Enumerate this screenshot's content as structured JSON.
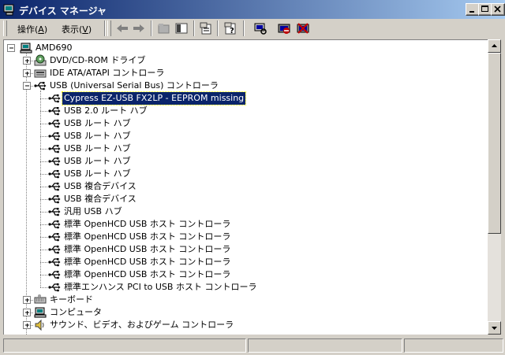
{
  "window": {
    "title": "デバイス マネージャ"
  },
  "menu": [
    {
      "label": "操作(",
      "key": "A",
      "suffix": ")"
    },
    {
      "label": "表示(",
      "key": "V",
      "suffix": ")"
    }
  ],
  "tree": {
    "root": "AMD690",
    "items": [
      {
        "label": "DVD/CD-ROM ドライブ",
        "icon": "cdrom-icon",
        "level": 1,
        "expander": "plus"
      },
      {
        "label": "IDE ATA/ATAPI コントローラ",
        "icon": "ide-controller-icon",
        "level": 1,
        "expander": "plus"
      },
      {
        "label": "USB (Universal Serial Bus) コントローラ",
        "icon": "usb-icon",
        "level": 1,
        "expander": "minus"
      },
      {
        "label": "Cypress EZ-USB FX2LP - EEPROM missing",
        "icon": "usb-icon",
        "level": 2,
        "selected": true
      },
      {
        "label": "USB 2.0 ルート ハブ",
        "icon": "usb-icon",
        "level": 2
      },
      {
        "label": "USB ルート ハブ",
        "icon": "usb-icon",
        "level": 2
      },
      {
        "label": "USB ルート ハブ",
        "icon": "usb-icon",
        "level": 2
      },
      {
        "label": "USB ルート ハブ",
        "icon": "usb-icon",
        "level": 2
      },
      {
        "label": "USB ルート ハブ",
        "icon": "usb-icon",
        "level": 2
      },
      {
        "label": "USB ルート ハブ",
        "icon": "usb-icon",
        "level": 2
      },
      {
        "label": "USB 複合デバイス",
        "icon": "usb-icon",
        "level": 2
      },
      {
        "label": "USB 複合デバイス",
        "icon": "usb-icon",
        "level": 2
      },
      {
        "label": "汎用 USB ハブ",
        "icon": "usb-icon",
        "level": 2
      },
      {
        "label": "標準 OpenHCD USB ホスト コントローラ",
        "icon": "usb-icon",
        "level": 2
      },
      {
        "label": "標準 OpenHCD USB ホスト コントローラ",
        "icon": "usb-icon",
        "level": 2
      },
      {
        "label": "標準 OpenHCD USB ホスト コントローラ",
        "icon": "usb-icon",
        "level": 2
      },
      {
        "label": "標準 OpenHCD USB ホスト コントローラ",
        "icon": "usb-icon",
        "level": 2
      },
      {
        "label": "標準 OpenHCD USB ホスト コントローラ",
        "icon": "usb-icon",
        "level": 2
      },
      {
        "label": "標準エンハンス PCI to USB ホスト コントローラ",
        "icon": "usb-icon",
        "level": 2
      },
      {
        "label": "キーボード",
        "icon": "keyboard-icon",
        "level": 1,
        "expander": "plus"
      },
      {
        "label": "コンピュータ",
        "icon": "computer-icon",
        "level": 1,
        "expander": "plus"
      },
      {
        "label": "サウンド、ビデオ、およびゲーム コントローラ",
        "icon": "sound-icon",
        "level": 1,
        "expander": "plus"
      }
    ]
  },
  "colors": {
    "titlebar_start": "#0a246a",
    "titlebar_end": "#a6caf0",
    "selection": "#0a246a",
    "face": "#d4d0c8"
  }
}
